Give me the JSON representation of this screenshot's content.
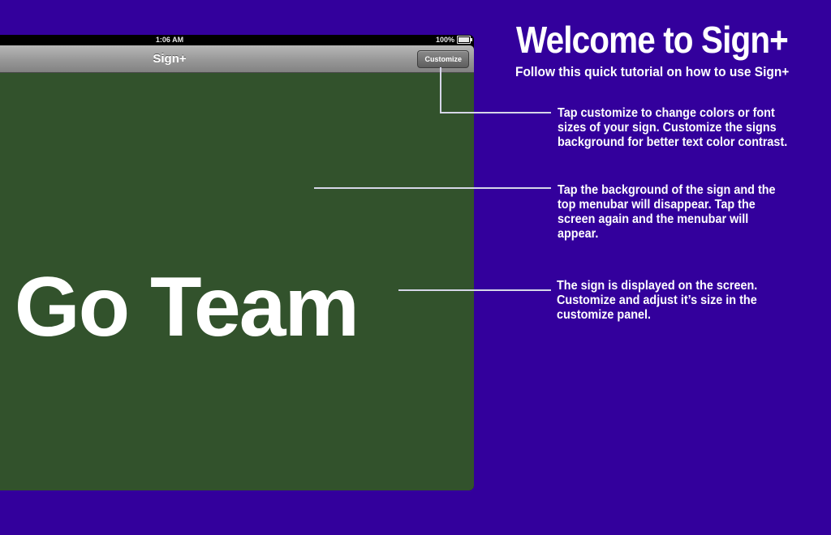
{
  "device": {
    "status_bar": {
      "time": "1:06 AM",
      "battery": "100%"
    },
    "nav_bar": {
      "title": "Sign+",
      "customize_label": "Customize"
    },
    "sign": {
      "text": "Go Team",
      "background_color": "#32522c",
      "text_color": "#ffffff"
    }
  },
  "tutorial": {
    "title": "Welcome to Sign+",
    "subtitle": "Follow this quick tutorial on how to use Sign+",
    "callouts": [
      {
        "lines": [
          "Tap customize to change colors or font",
          "sizes of your sign. Customize the signs",
          "background for better text color contrast."
        ]
      },
      {
        "lines": [
          "Tap the background of the sign and the",
          "top menubar will disappear. Tap the",
          "screen again and the menubar will",
          "appear."
        ]
      },
      {
        "lines": [
          "The sign is displayed on the screen.",
          "Customize and adjust it’s size in the",
          "customize panel."
        ]
      }
    ]
  },
  "colors": {
    "background": "#33009c",
    "text": "#ffffff",
    "leader_line": "#d6d6e8"
  },
  "icons": {
    "battery": "battery-icon"
  }
}
